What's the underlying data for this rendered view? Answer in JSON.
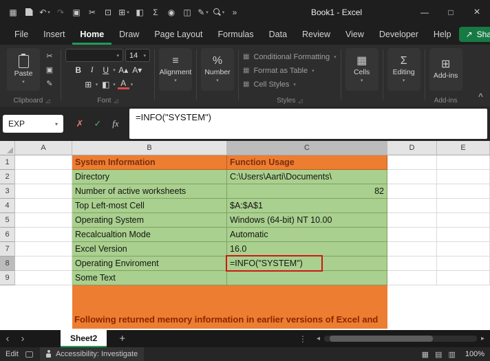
{
  "colors": {
    "accent_green": "#1f9d55",
    "share_button_green": "#177a44",
    "cell_orange": "#ED7D31",
    "cell_green": "#A9D08E",
    "annotation_red": "#d01616",
    "maroon_text": "#7b2d0e"
  },
  "icons": {
    "dropdown": "▾",
    "collapse_ribbon": "^",
    "minimize": "—",
    "maximize": "□",
    "close": "×",
    "cancel": "✗",
    "confirm": "✓",
    "more": "»",
    "vertical_dots": "⋮",
    "nav_left": "‹",
    "nav_right": "›",
    "scroll_left": "◂",
    "scroll_right": "▸",
    "add_sheet": "+",
    "launcher": "◿",
    "share_arrow": "↗",
    "align": "≡",
    "percent": "%",
    "cells_grid": "▦",
    "sum": "Σ",
    "addins_grid": "⊞",
    "style_swatch": "▦",
    "borders": "⊞",
    "fill": "◧",
    "normal_view": "▦",
    "page_layout_view": "▤",
    "page_break_view": "▥"
  },
  "title_bar": {
    "title": "Book1 - Excel",
    "qat": [
      "▦",
      "↶",
      "↷",
      "▣",
      "✂",
      "⊡",
      "⊞",
      "◧",
      "Σ",
      "◉",
      "◫",
      "✎"
    ]
  },
  "menu": {
    "tabs": [
      "File",
      "Insert",
      "Home",
      "Draw",
      "Page Layout",
      "Formulas",
      "Data",
      "Review",
      "View",
      "Developer",
      "Help"
    ],
    "share_label": "Share"
  },
  "ribbon": {
    "paste_label": "Paste",
    "clipboard_label": "Clipboard",
    "font_label": "Font",
    "font_size": "14",
    "bold": "B",
    "italic": "I",
    "underline": "U",
    "grow_font": "A▴",
    "shrink_font": "A▾",
    "font_color": "A",
    "alignment_label": "Alignment",
    "number_label": "Number",
    "styles": {
      "items": [
        "Conditional Formatting",
        "Format as Table",
        "Cell Styles"
      ],
      "label": "Styles"
    },
    "cells_label": "Cells",
    "editing_label": "Editing",
    "addins_label": "Add-ins"
  },
  "formula_bar": {
    "name_box": "EXP",
    "fx_label": "fx",
    "formula": "=INFO(\"SYSTEM\")"
  },
  "grid": {
    "columns": [
      "A",
      "B",
      "C",
      "D",
      "E"
    ],
    "rows": [
      {
        "n": "1",
        "b": "System Information",
        "c": "Function Usage"
      },
      {
        "n": "2",
        "b": "Directory",
        "c": "C:\\Users\\Aarti\\Documents\\"
      },
      {
        "n": "3",
        "b": "Number of active worksheets",
        "c": "82"
      },
      {
        "n": "4",
        "b": "Top Left-most Cell",
        "c": "$A:$A$1"
      },
      {
        "n": "5",
        "b": "Operating System",
        "c": "Windows (64-bit) NT 10.00"
      },
      {
        "n": "6",
        "b": "Recalcualtion Mode",
        "c": "Automatic"
      },
      {
        "n": "7",
        "b": "Excel Version",
        "c": "16.0"
      },
      {
        "n": "8",
        "b": "Operating Enviroment",
        "c": "=INFO(\"SYSTEM\")"
      },
      {
        "n": "9",
        "b": "Some Text",
        "c": ""
      }
    ],
    "banner": "Following returned memory information in earlier versions of Excel and"
  },
  "sheet_bar": {
    "active_tab": "Sheet2"
  },
  "status_bar": {
    "mode": "Edit",
    "accessibility_label": "Accessibility: Investigate",
    "zoom": "100%"
  }
}
